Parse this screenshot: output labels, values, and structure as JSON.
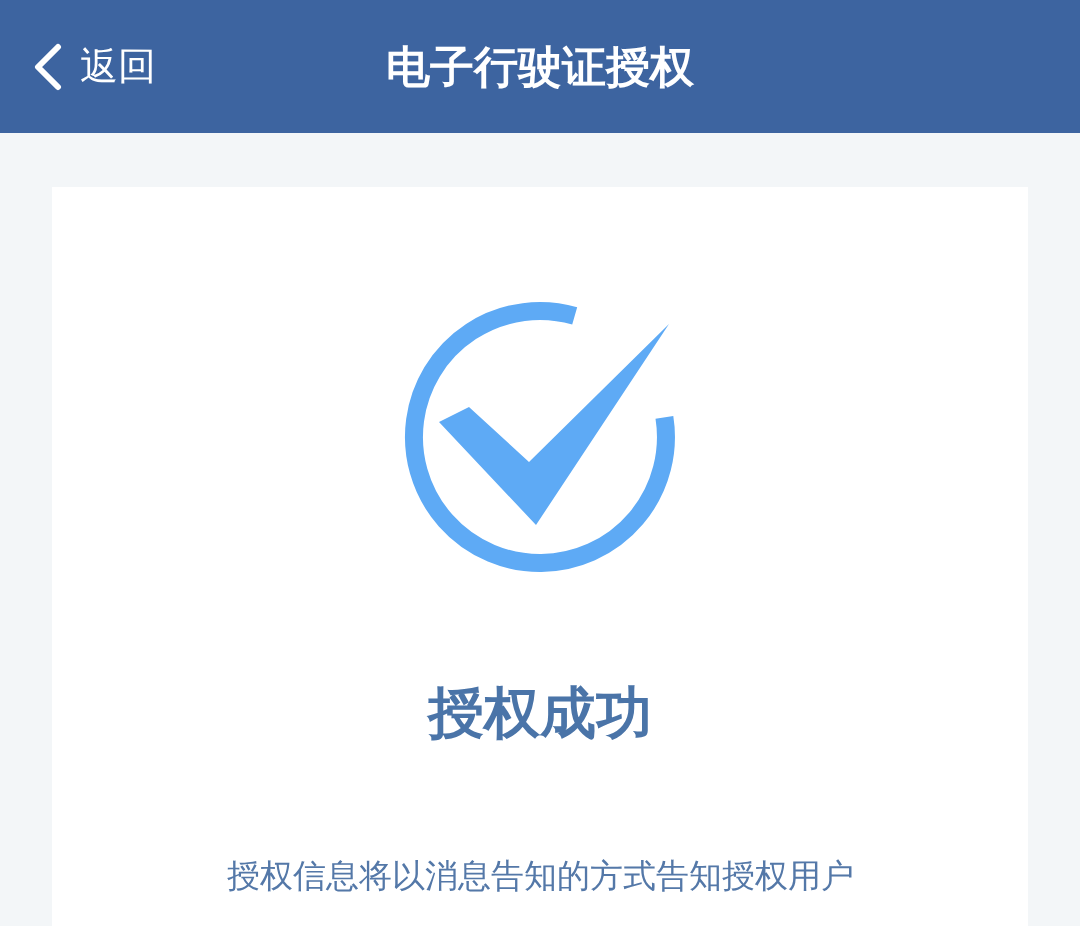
{
  "header": {
    "back_label": "返回",
    "title": "电子行驶证授权"
  },
  "result": {
    "title": "授权成功",
    "message": "授权信息将以消息告知的方式告知授权用户"
  }
}
